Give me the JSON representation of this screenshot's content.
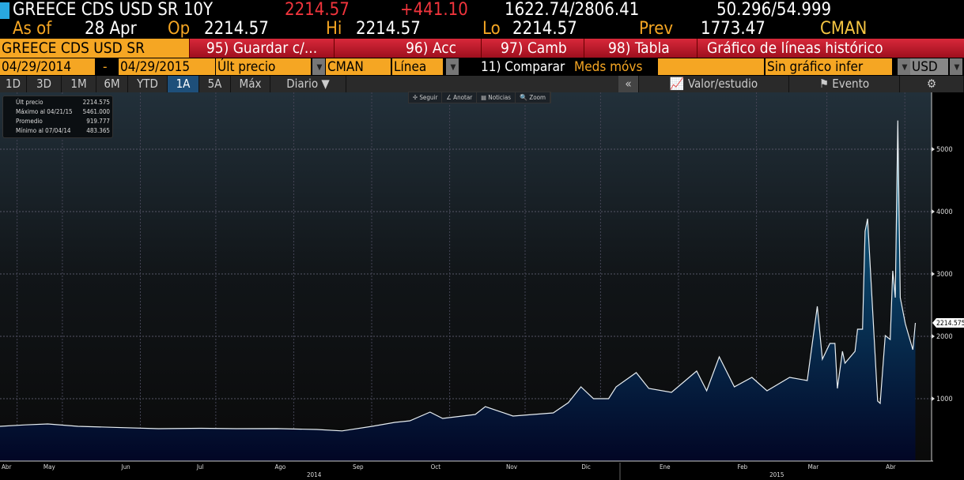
{
  "header": {
    "security": "GREECE CDS USD SR 10Y",
    "last": "2214.57",
    "change": "+441.10",
    "bid_ask": "1622.74/2806.41",
    "spread": "50.296/54.999",
    "as_of_label": "As of",
    "as_of": "28 Apr",
    "op_label": "Op",
    "op": "2214.57",
    "hi_label": "Hi",
    "hi": "2214.57",
    "lo_label": "Lo",
    "lo": "2214.57",
    "prev_label": "Prev",
    "prev": "1773.47",
    "source": "CMAN"
  },
  "toolbar": {
    "security_short": "GREECE CDS USD SR",
    "save": "95) Guardar c/...",
    "actions": "96) Acc",
    "change": "97) Camb",
    "table": "98) Tabla",
    "title": "Gráfico de líneas histórico"
  },
  "controls": {
    "start_date": "04/29/2014",
    "dash": "-",
    "end_date": "04/29/2015",
    "field": "Últ precio",
    "source": "CMAN",
    "chart_type": "Línea",
    "compare": "11) Comparar",
    "moving_avgs": "Meds móvs",
    "lower_chart": "Sin gráfico infer",
    "currency": "USD"
  },
  "tabs": [
    "1D",
    "3D",
    "1M",
    "6M",
    "YTD",
    "1A",
    "5A",
    "Máx",
    "Diario ▼"
  ],
  "active_tab": "1A",
  "panel": {
    "collapse": "«",
    "value_study": "Valor/estudio",
    "event": "Evento",
    "settings": "⚙"
  },
  "chart_tools": [
    "✢ Seguir",
    "∠ Anotar",
    "▤ Noticias",
    "🔍 Zoom"
  ],
  "legend": [
    {
      "label": "Últ precio",
      "value": "2214.575"
    },
    {
      "label": "Máximo al 04/21/15",
      "value": "5461.000"
    },
    {
      "label": "Promedio",
      "value": "919.777"
    },
    {
      "label": "Mínimo al 07/04/14",
      "value": "483.365"
    }
  ],
  "chart_data": {
    "type": "area",
    "title": "GREECE CDS USD SR 10Y",
    "ylim": [
      0,
      5900
    ],
    "yticks": [
      1000,
      2000,
      3000,
      4000,
      5000
    ],
    "last_label": "2214.575",
    "xlabel_unit": "days since 04/29/2014",
    "month_ticks": [
      {
        "label": "Abr",
        "day": -2
      },
      {
        "label": "May",
        "day": 16
      },
      {
        "label": "Jun",
        "day": 47
      },
      {
        "label": "Jul",
        "day": 77
      },
      {
        "label": "Ago",
        "day": 108
      },
      {
        "label": "Sep",
        "day": 139
      },
      {
        "label": "Oct",
        "day": 170
      },
      {
        "label": "Nov",
        "day": 200
      },
      {
        "label": "Dic",
        "day": 230
      },
      {
        "label": "Ene",
        "day": 261
      },
      {
        "label": "Feb",
        "day": 292
      },
      {
        "label": "Mar",
        "day": 320
      },
      {
        "label": "Abr",
        "day": 351
      }
    ],
    "years": [
      {
        "label": "2014",
        "day": 122
      },
      {
        "label": "2015",
        "day": 306
      }
    ],
    "points": [
      [
        0,
        557
      ],
      [
        10,
        580
      ],
      [
        19,
        595
      ],
      [
        31,
        557
      ],
      [
        45,
        540
      ],
      [
        63,
        519
      ],
      [
        80,
        525
      ],
      [
        94,
        519
      ],
      [
        110,
        520
      ],
      [
        126,
        506
      ],
      [
        136,
        483
      ],
      [
        148,
        557
      ],
      [
        157,
        620
      ],
      [
        163,
        645
      ],
      [
        171,
        785
      ],
      [
        176,
        683
      ],
      [
        189,
        747
      ],
      [
        193,
        873
      ],
      [
        204,
        721
      ],
      [
        220,
        772
      ],
      [
        226,
        937
      ],
      [
        231,
        1190
      ],
      [
        236,
        1000
      ],
      [
        242,
        1000
      ],
      [
        245,
        1190
      ],
      [
        253,
        1418
      ],
      [
        258,
        1165
      ],
      [
        267,
        1101
      ],
      [
        277,
        1443
      ],
      [
        281,
        1127
      ],
      [
        286,
        1671
      ],
      [
        292,
        1190
      ],
      [
        299,
        1342
      ],
      [
        305,
        1127
      ],
      [
        314,
        1342
      ],
      [
        321,
        1291
      ],
      [
        325,
        2481
      ],
      [
        327,
        1633
      ],
      [
        330,
        1886
      ],
      [
        332,
        1886
      ],
      [
        333,
        1165
      ],
      [
        335,
        1760
      ],
      [
        336,
        1570
      ],
      [
        340,
        1760
      ],
      [
        341,
        2114
      ],
      [
        343,
        2114
      ],
      [
        344,
        3684
      ],
      [
        345,
        3886
      ],
      [
        349,
        962
      ],
      [
        350,
        924
      ],
      [
        352,
        2013
      ],
      [
        354,
        1949
      ],
      [
        355,
        3051
      ],
      [
        356,
        2620
      ],
      [
        357,
        5461
      ],
      [
        358,
        2620
      ],
      [
        360,
        2203
      ],
      [
        363,
        1785
      ],
      [
        364,
        2215
      ]
    ]
  }
}
